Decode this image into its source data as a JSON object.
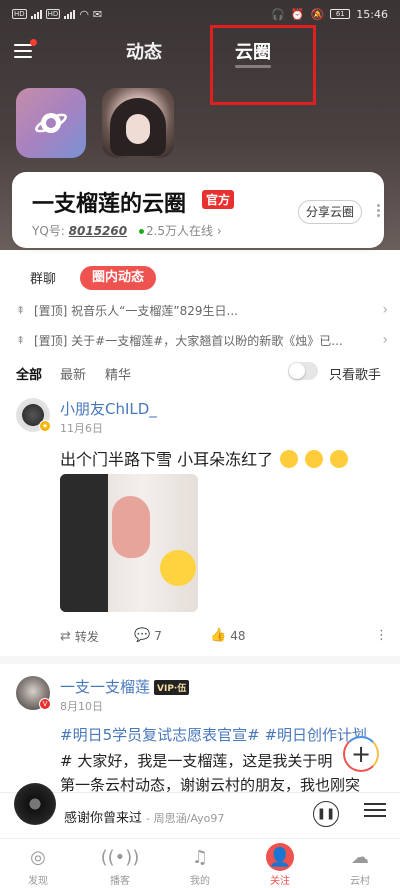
{
  "status_bar": {
    "time": "15:46",
    "signal_1": "HD",
    "signal_2": "HD",
    "battery": "61"
  },
  "top_nav": {
    "tabs": [
      {
        "label": "动态"
      },
      {
        "label": "云圈"
      }
    ],
    "active_tab": "云圈"
  },
  "circle": {
    "name": "一支榴莲的云圈",
    "badge": "官方",
    "yq_label": "YQ号:",
    "yq_number": "8015260",
    "online": "2.5万人在线",
    "share_label": "分享云圈"
  },
  "sub_tabs": [
    {
      "label": "群聊"
    },
    {
      "label": "圈内动态"
    }
  ],
  "pinned": [
    {
      "text": "[置顶] 祝音乐人“一支榴莲”829生日..."
    },
    {
      "text": "[置顶] 关于#一支榴莲#，大家翘首以盼的新歌《烛》已..."
    }
  ],
  "filters": {
    "items": [
      {
        "label": "全部"
      },
      {
        "label": "最新"
      },
      {
        "label": "精华"
      }
    ],
    "toggle_label": "只看歌手",
    "toggle_on": false
  },
  "posts": [
    {
      "username": "小朋友ChILD_",
      "date": "11月6日",
      "text": "出个门半路下雪 小耳朵冻红了",
      "actions": {
        "repost_label": "转发",
        "comments": "7",
        "likes": "48"
      }
    },
    {
      "username": "一支一支榴莲",
      "vip_badge": "VIP·伍",
      "date": "8月10日",
      "tags": "#明日5学员复试志愿表官宣# #明日创作计划",
      "line1": "# 大家好，我是一支榴莲，这是我关于明",
      "line2": "第一条云村动态，谢谢云村的朋友，我也刚突"
    }
  ],
  "player": {
    "song": "感谢你曾来过",
    "artist": "- 周思涵/Ayo97"
  },
  "bottom_nav": [
    {
      "label": "发现",
      "icon": "discover-icon"
    },
    {
      "label": "播客",
      "icon": "podcast-icon"
    },
    {
      "label": "我的",
      "icon": "music-note-icon"
    },
    {
      "label": "关注",
      "icon": "follow-icon"
    },
    {
      "label": "云村",
      "icon": "cloud-village-icon"
    }
  ],
  "colors": {
    "accent": "#ef5350",
    "link": "#4878bc",
    "header_bg": "#3a3434"
  }
}
